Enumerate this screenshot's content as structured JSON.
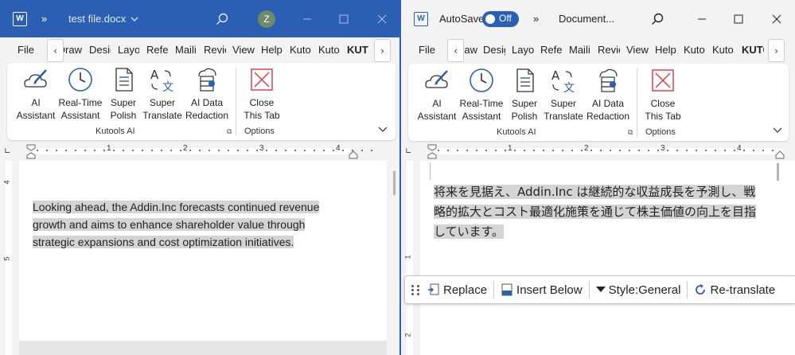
{
  "left_window": {
    "file_name": "test file.docx",
    "more_glyph": "»",
    "avatar_letter": "Z",
    "tabs": [
      "File",
      "Draw",
      "Design",
      "Layout",
      "References",
      "Mailings",
      "Review",
      "View",
      "Help",
      "Kutools",
      "Kutools",
      "KUTOOLS"
    ],
    "ribbon_buttons": [
      {
        "line1": "AI",
        "line2": "Assistant"
      },
      {
        "line1": "Real-Time",
        "line2": "Assistant"
      },
      {
        "line1": "Super",
        "line2": "Polish"
      },
      {
        "line1": "Super",
        "line2": "Translate"
      },
      {
        "line1": "AI Data",
        "line2": "Redaction"
      },
      {
        "line1": "Close",
        "line2": "This Tab"
      }
    ],
    "groups": [
      "Kutools AI",
      "Options"
    ],
    "text_lines": [
      "Looking ahead, the Addin.Inc forecasts continued revenue",
      "growth and aims to enhance shareholder value through",
      "strategic expansions and cost optimization initiatives."
    ],
    "ruler_numbers": [
      "1",
      "2",
      "3",
      "4"
    ],
    "vruler_numbers": [
      "4",
      "5"
    ]
  },
  "right_window": {
    "autosave_label": "AutoSave",
    "toggle_state": "Off",
    "more_glyph": "»",
    "doc_title": "Document...",
    "tabs": [
      "File",
      "Draw",
      "Design",
      "Layout",
      "References",
      "Mailings",
      "Review",
      "View",
      "Help",
      "Kutools",
      "Kutools",
      "KUTOOLS"
    ],
    "ribbon_buttons": [
      {
        "line1": "AI",
        "line2": "Assistant"
      },
      {
        "line1": "Real-Time",
        "line2": "Assistant"
      },
      {
        "line1": "Super",
        "line2": "Polish"
      },
      {
        "line1": "Super",
        "line2": "Translate"
      },
      {
        "line1": "AI Data",
        "line2": "Redaction"
      },
      {
        "line1": "Close",
        "line2": "This Tab"
      }
    ],
    "groups": [
      "Kutools AI",
      "Options"
    ],
    "text_lines": [
      "将来を見据え、Addin.Inc は継続的な収益成長を予測し、戦",
      "略的拡大とコスト最適化施策を通じて株主価値の向上を目指",
      "しています。"
    ],
    "ruler_numbers": [
      "1",
      "2",
      "3",
      "4"
    ],
    "vruler_numbers": [
      "1",
      "2"
    ]
  },
  "float_toolbar": {
    "replace": "Replace",
    "insert_below": "Insert Below",
    "style": "Style:General",
    "retranslate": "Re-translate"
  },
  "colors": {
    "title_blue": "#2b5fb3",
    "highlight": "#d4d4d4",
    "close_red": "#d9363e"
  }
}
